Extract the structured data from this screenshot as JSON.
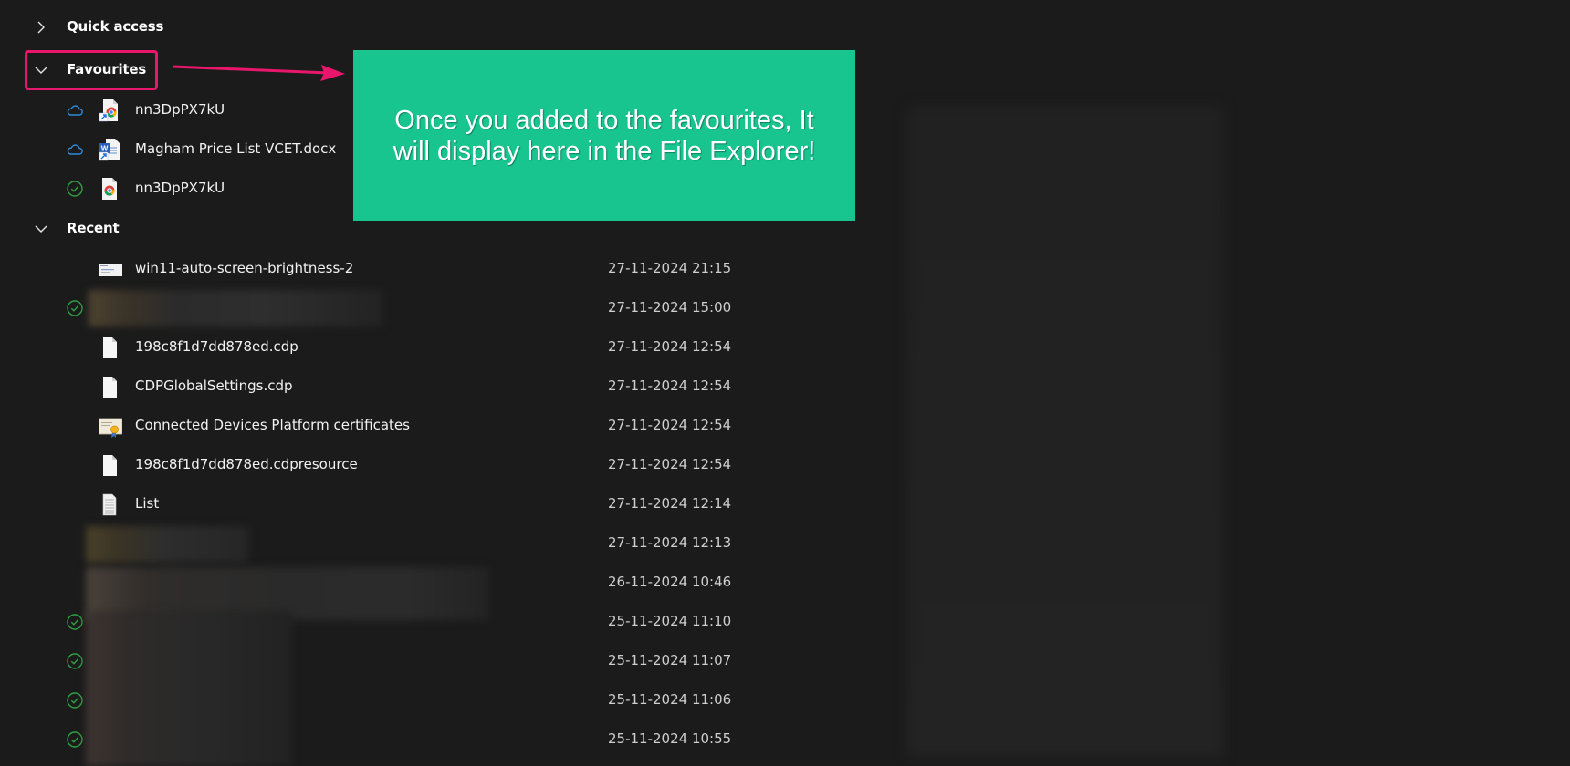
{
  "sidebar": {
    "quick_access": {
      "label": "Quick access",
      "expanded": false
    },
    "favourites": {
      "label": "Favourites",
      "expanded": true,
      "items": [
        {
          "name": "nn3DpPX7kU",
          "status": "cloud",
          "icon": "chrome-shortcut-icon"
        },
        {
          "name": "Magham Price List VCET.docx",
          "status": "cloud",
          "icon": "word-shortcut-icon"
        },
        {
          "name": "nn3DpPX7kU",
          "status": "synced",
          "icon": "chrome-file-icon"
        }
      ]
    },
    "recent": {
      "label": "Recent",
      "expanded": true,
      "items": [
        {
          "name": "win11-auto-screen-brightness-2",
          "date": "27-11-2024 21:15",
          "status": "none",
          "icon": "image-thumbnail-icon"
        },
        {
          "name": "",
          "date": "27-11-2024 15:00",
          "status": "synced",
          "icon": "redacted",
          "redacted": true
        },
        {
          "name": "198c8f1d7dd878ed.cdp",
          "date": "27-11-2024 12:54",
          "status": "none",
          "icon": "blank-file-icon"
        },
        {
          "name": "CDPGlobalSettings.cdp",
          "date": "27-11-2024 12:54",
          "status": "none",
          "icon": "blank-file-icon"
        },
        {
          "name": "Connected Devices Platform certificates",
          "date": "27-11-2024 12:54",
          "status": "none",
          "icon": "certificate-icon"
        },
        {
          "name": "198c8f1d7dd878ed.cdpresource",
          "date": "27-11-2024 12:54",
          "status": "none",
          "icon": "blank-file-icon"
        },
        {
          "name": "List",
          "date": "27-11-2024 12:14",
          "status": "none",
          "icon": "text-file-icon"
        },
        {
          "name": "",
          "date": "27-11-2024 12:13",
          "status": "none",
          "icon": "redacted",
          "redacted": true
        },
        {
          "name": "",
          "date": "26-11-2024 10:46",
          "status": "none",
          "icon": "redacted",
          "redacted": true
        },
        {
          "name": "",
          "date": "25-11-2024 11:10",
          "status": "synced",
          "icon": "redacted",
          "redacted": true
        },
        {
          "name": "",
          "date": "25-11-2024 11:07",
          "status": "synced",
          "icon": "redacted",
          "redacted": true
        },
        {
          "name": "",
          "date": "25-11-2024 11:06",
          "status": "synced",
          "icon": "redacted",
          "redacted": true
        },
        {
          "name": "",
          "date": "25-11-2024 10:55",
          "status": "synced",
          "icon": "redacted",
          "redacted": true
        }
      ]
    }
  },
  "annotation": {
    "callout_text": "Once you added to the favourites, It will display here in the File Explorer!",
    "callout_color": "#18c58f",
    "highlight_color": "#e8176c"
  },
  "colors": {
    "background": "#1b1b1b",
    "cloud_status": "#2f8ae0",
    "synced_status": "#2ea043",
    "date_text": "#cfcfcf"
  }
}
